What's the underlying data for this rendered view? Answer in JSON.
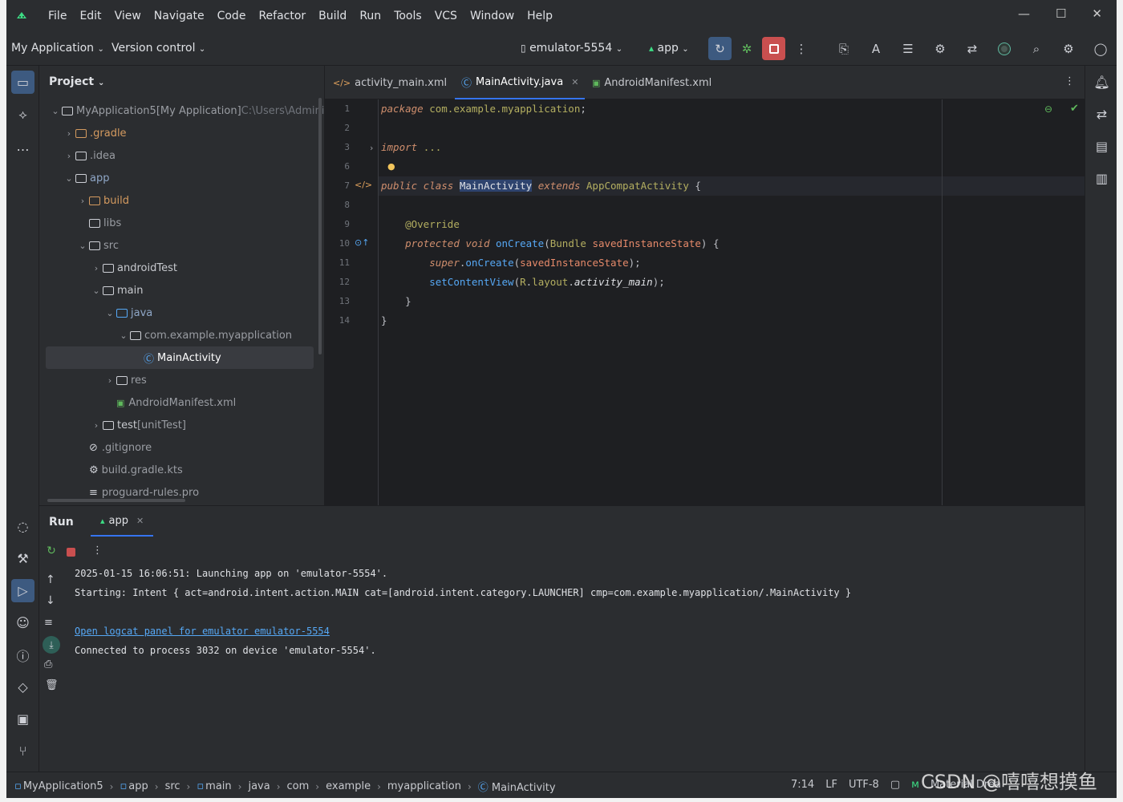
{
  "menu": [
    "File",
    "Edit",
    "View",
    "Navigate",
    "Code",
    "Refactor",
    "Build",
    "Run",
    "Tools",
    "VCS",
    "Window",
    "Help"
  ],
  "toolbar": {
    "project": "My Application",
    "vcs": "Version control",
    "device": "emulator-5554",
    "run_config": "app"
  },
  "project_panel": {
    "title": "Project",
    "items": [
      {
        "label": "MyApplication5",
        "extra": "[My Application]",
        "path": "C:\\Users\\Adminis",
        "level": 0,
        "open": true,
        "kind": "module"
      },
      {
        "label": ".gradle",
        "level": 1,
        "open": false,
        "kind": "folder-orange"
      },
      {
        "label": ".idea",
        "level": 1,
        "open": false,
        "kind": "folder"
      },
      {
        "label": "app",
        "level": 1,
        "open": true,
        "kind": "module"
      },
      {
        "label": "build",
        "level": 2,
        "open": false,
        "kind": "folder-orange"
      },
      {
        "label": "libs",
        "level": 2,
        "open": null,
        "kind": "folder"
      },
      {
        "label": "src",
        "level": 2,
        "open": true,
        "kind": "folder"
      },
      {
        "label": "androidTest",
        "level": 3,
        "open": false,
        "kind": "folder"
      },
      {
        "label": "main",
        "level": 3,
        "open": true,
        "kind": "folder"
      },
      {
        "label": "java",
        "level": 4,
        "open": true,
        "kind": "folder-blue"
      },
      {
        "label": "com.example.myapplication",
        "level": 5,
        "open": true,
        "kind": "package"
      },
      {
        "label": "MainActivity",
        "level": 6,
        "open": null,
        "kind": "class",
        "selected": true
      },
      {
        "label": "res",
        "level": 4,
        "open": false,
        "kind": "folder"
      },
      {
        "label": "AndroidManifest.xml",
        "level": 4,
        "open": null,
        "kind": "manifest"
      },
      {
        "label": "test",
        "extra": "[unitTest]",
        "level": 3,
        "open": false,
        "kind": "folder"
      },
      {
        "label": ".gitignore",
        "level": 2,
        "open": null,
        "kind": "ignore"
      },
      {
        "label": "build.gradle.kts",
        "level": 2,
        "open": null,
        "kind": "gradle"
      },
      {
        "label": "proguard-rules.pro",
        "level": 2,
        "open": null,
        "kind": "text"
      }
    ]
  },
  "editor": {
    "tabs": [
      {
        "label": "activity_main.xml",
        "active": false
      },
      {
        "label": "MainActivity.java",
        "active": true
      },
      {
        "label": "AndroidManifest.xml",
        "active": false
      }
    ],
    "lines": [
      {
        "n": "1",
        "html": "<span class='kw'>package</span> <span class='ann'>com.example.myapplication</span>;"
      },
      {
        "n": "2",
        "html": ""
      },
      {
        "n": "3",
        "html": "<span class='kw'>import</span> <span class='ann'>...</span>"
      },
      {
        "n": "6",
        "html": ""
      },
      {
        "n": "7",
        "html": "<span class='kw'>public class</span> <span class='hl cls'>MainActivity</span> <span class='kw'>extends</span> <span class='ann'>AppCompatActivity</span> {"
      },
      {
        "n": "8",
        "html": ""
      },
      {
        "n": "9",
        "html": "    <span class='ann'>@Override</span>"
      },
      {
        "n": "10",
        "html": "    <span class='kw'>protected void</span> <span class='fn'>onCreate</span>(<span class='ann'>Bundle</span> <span class='prm'>savedInstanceState</span>) {"
      },
      {
        "n": "11",
        "html": "        <span class='kw'>super</span>.<span class='fn'>onCreate</span>(<span class='prm'>savedInstanceState</span>);"
      },
      {
        "n": "12",
        "html": "        <span class='fn'>setContentView</span>(<span class='ann'>R</span>.<span class='ann'>layout</span>.<span class='cls' style='font-style:italic'>activity_main</span>);"
      },
      {
        "n": "13",
        "html": "    }"
      },
      {
        "n": "14",
        "html": "}"
      }
    ]
  },
  "run": {
    "title": "Run",
    "tab": "app",
    "console": [
      {
        "text": "2025-01-15 16:06:51: Launching app on 'emulator-5554'.",
        "link": false
      },
      {
        "text": "Starting: Intent { act=android.intent.action.MAIN cat=[android.intent.category.LAUNCHER] cmp=com.example.myapplication/.MainActivity }",
        "link": false
      },
      {
        "text": "",
        "link": false
      },
      {
        "text": "Open logcat panel for emulator emulator-5554",
        "link": true
      },
      {
        "text": "Connected to process 3032 on device 'emulator-5554'.",
        "link": false
      }
    ]
  },
  "status": {
    "breadcrumbs": [
      "MyApplication5",
      "app",
      "src",
      "main",
      "java",
      "com",
      "example",
      "myapplication",
      "MainActivity"
    ],
    "position": "7:14",
    "line_sep": "LF",
    "encoding": "UTF-8",
    "theme": "Material Drea"
  },
  "watermark": "CSDN @嘻嘻想摸鱼"
}
